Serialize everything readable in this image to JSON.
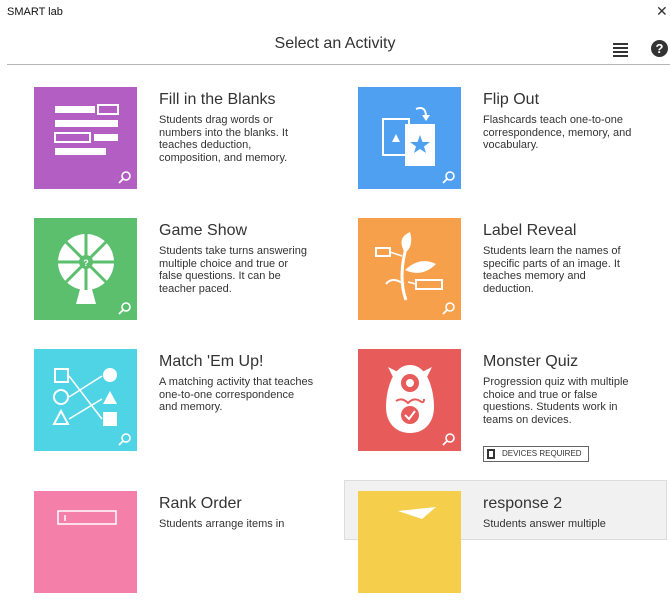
{
  "window": {
    "app_title": "SMART lab",
    "close_label": "✕"
  },
  "header": {
    "title": "Select an Activity",
    "help_label": "?"
  },
  "colors": {
    "purple": "#b35ec3",
    "blue": "#4fa0f0",
    "green": "#5bbf6e",
    "orange": "#f7a04c",
    "cyan": "#4fd4e6",
    "red": "#e85b5b",
    "pink": "#f47fa8",
    "yellow": "#f5cf4b"
  },
  "activities": [
    {
      "title": "Fill in the Blanks",
      "description": "Students drag words or numbers into the blanks. It teaches deduction, composition, and memory.",
      "icon": "fill-in-the-blanks-icon"
    },
    {
      "title": "Flip Out",
      "description": "Flashcards teach one-to-one correspondence, memory, and vocabulary.",
      "icon": "flashcards-icon"
    },
    {
      "title": "Game Show",
      "description": "Students take turns answering multiple choice and true or false questions. It can be teacher paced.",
      "icon": "prize-wheel-icon"
    },
    {
      "title": "Label Reveal",
      "description": "Students learn the names of specific parts of an image. It teaches memory and deduction.",
      "icon": "labelled-plant-icon"
    },
    {
      "title": "Match 'Em Up!",
      "description": "A matching activity that teaches one-to-one correspondence and memory.",
      "icon": "matching-shapes-icon"
    },
    {
      "title": "Monster Quiz",
      "description": "Progression quiz with multiple choice and true or false questions. Students work in teams on devices.",
      "icon": "monster-egg-icon",
      "badge": "DEVICES REQUIRED"
    },
    {
      "title": "Rank Order",
      "description": "Students arrange items in",
      "icon": "ranked-list-icon"
    },
    {
      "title": "response 2",
      "description": "Students answer multiple",
      "icon": "response-icon"
    }
  ]
}
